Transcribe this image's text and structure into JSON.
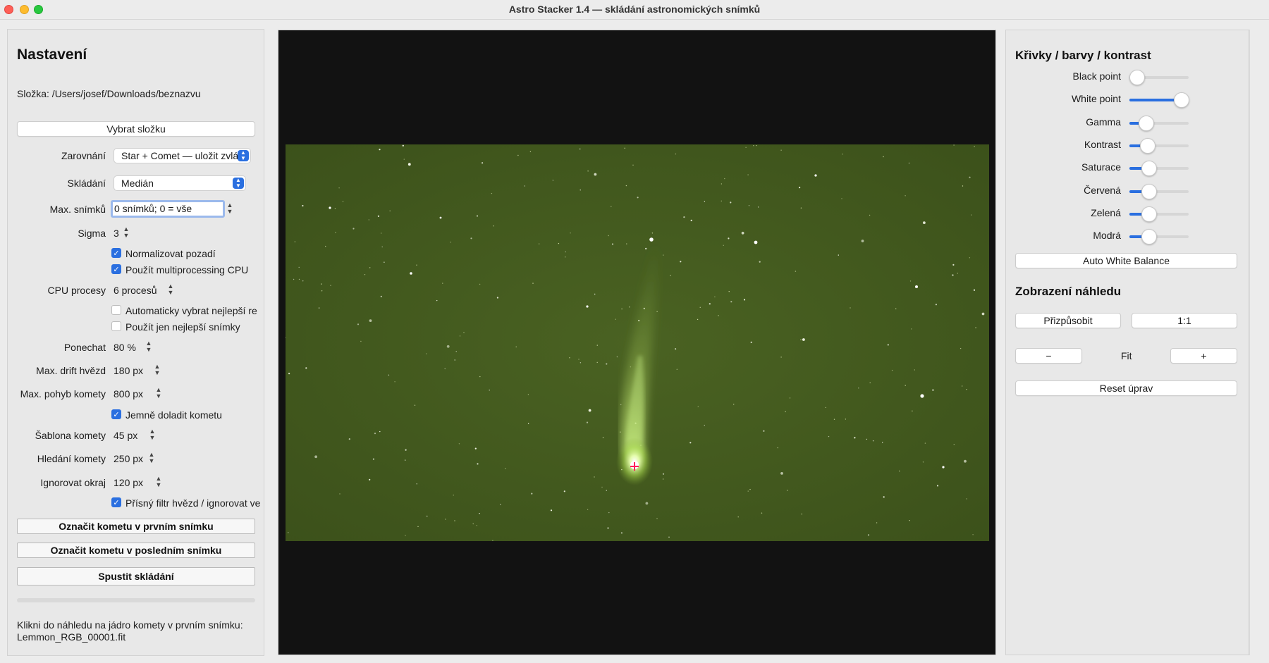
{
  "window": {
    "title": "Astro Stacker 1.4 — skládání astronomických snímků"
  },
  "left": {
    "title": "Nastavení",
    "folder_label": "Složka: /Users/josef/Downloads/beznazvu",
    "choose_folder": "Vybrat složku",
    "align_label": "Zarovnání",
    "align_value": "Star + Comet — uložit zvlášť",
    "stack_label": "Skládání",
    "stack_value": "Medián",
    "max_frames_label": "Max. snímků",
    "max_frames_value": "0 snímků; 0 = vše",
    "sigma_label": "Sigma",
    "sigma_value": "3",
    "normalize_bg": "Normalizovat pozadí",
    "use_mp": "Použít multiprocessing CPU",
    "cpu_label": "CPU procesy",
    "cpu_value": "6 procesů",
    "auto_best": "Automaticky vybrat nejlepší re",
    "use_best": "Použít jen nejlepší snímky",
    "keep_label": "Ponechat",
    "keep_value": "80 %",
    "drift_label": "Max. drift hvězd",
    "drift_value": "180 px",
    "comet_move_label": "Max. pohyb komety",
    "comet_move_value": "800 px",
    "fine_comet": "Jemně doladit kometu",
    "template_label": "Šablona komety",
    "template_value": "45 px",
    "search_label": "Hledání komety",
    "search_value": "250 px",
    "ignore_label": "Ignorovat okraj",
    "ignore_value": "120 px",
    "strict_filter": "Přísný filtr hvězd / ignorovat ve",
    "mark_first": "Označit kometu v prvním snímku",
    "mark_last": "Označit kometu v posledním snímku",
    "start": "Spustit skládání",
    "status_line1": "Klikni do náhledu na jádro komety v prvním snímku:",
    "status_line2": "Lemmon_RGB_00001.fit"
  },
  "checks": {
    "normalize_bg": true,
    "use_mp": true,
    "auto_best": false,
    "use_best": false,
    "fine_comet": true,
    "strict_filter": true
  },
  "right": {
    "curves_title": "Křivky / barvy / kontrast",
    "sliders": [
      {
        "label": "Black point",
        "value": 0.13
      },
      {
        "label": "White point",
        "value": 0.88
      },
      {
        "label": "Gamma",
        "value": 0.28
      },
      {
        "label": "Kontrast",
        "value": 0.31
      },
      {
        "label": "Saturace",
        "value": 0.33
      },
      {
        "label": "Červená",
        "value": 0.33
      },
      {
        "label": "Zelená",
        "value": 0.33
      },
      {
        "label": "Modrá",
        "value": 0.33
      }
    ],
    "awb": "Auto White Balance",
    "preview_title": "Zobrazení náhledu",
    "fit_btn": "Přizpůsobit",
    "one_btn": "1:1",
    "minus": "−",
    "zoom_label": "Fit",
    "plus": "+",
    "reset": "Reset úprav"
  },
  "colors": {
    "accent": "#2a6fe0",
    "sky": "#445a1e",
    "marker": "#ff1f5a"
  }
}
